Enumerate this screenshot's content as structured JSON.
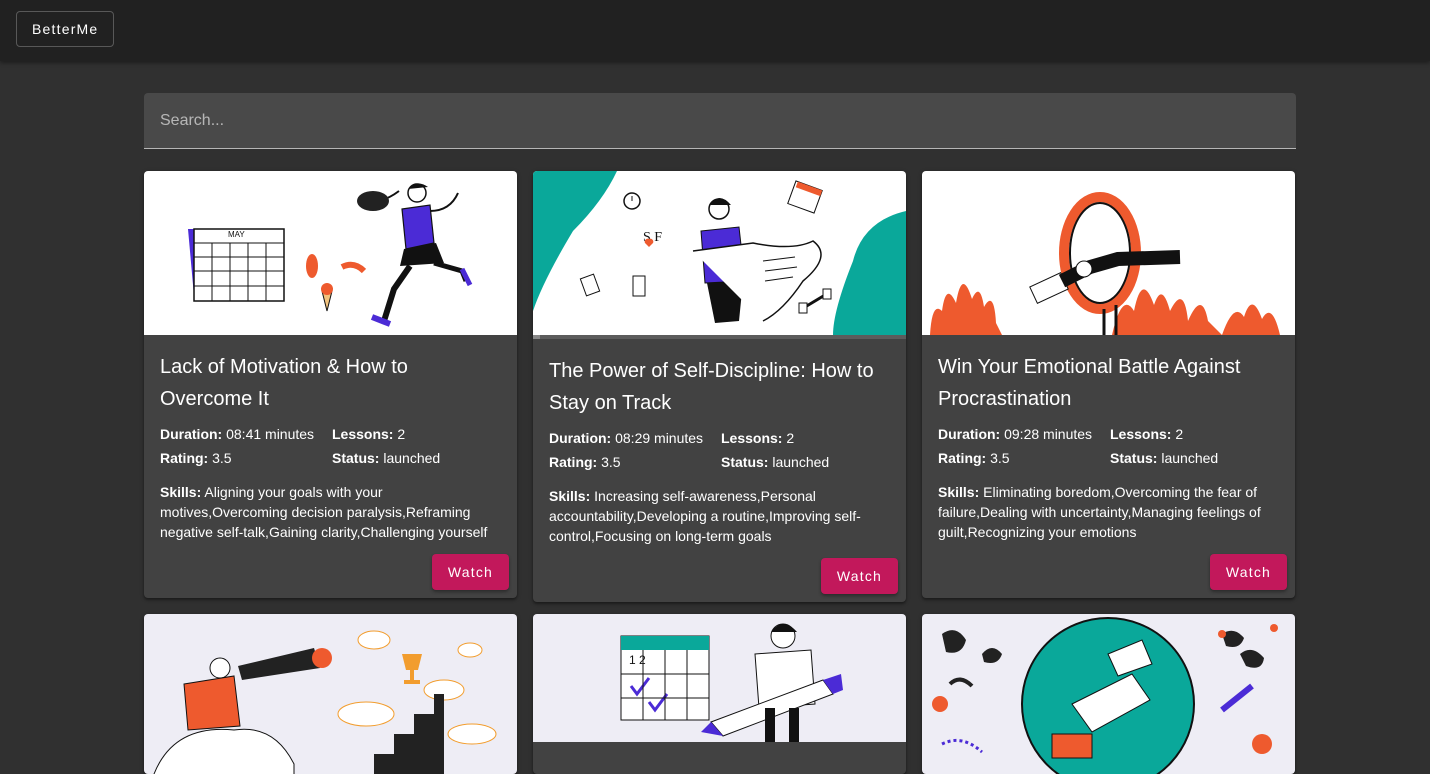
{
  "app": {
    "brand": "BetterMe"
  },
  "search": {
    "placeholder": "Search..."
  },
  "labels": {
    "duration": "Duration:",
    "lessons": "Lessons:",
    "rating": "Rating:",
    "status": "Status:",
    "skills": "Skills:"
  },
  "cards": [
    {
      "title": "Lack of Motivation & How to Overcome It",
      "duration": "08:41 minutes",
      "lessons": "2",
      "rating": "3.5",
      "status": "launched",
      "skills": "Aligning your goals with your motives,Overcoming decision paralysis,Reframing negative self-talk,Gaining clarity,Challenging yourself",
      "action": "Watch",
      "image_icon": "calendar-and-running-woman-illustration"
    },
    {
      "title": "The Power of Self-Discipline: How to Stay on Track",
      "duration": "08:29 minutes",
      "lessons": "2",
      "rating": "3.5",
      "status": "launched",
      "skills": "Increasing self-awareness,Personal accountability,Developing a routine,Improving self-control,Focusing on long-term goals",
      "action": "Watch",
      "image_icon": "woman-with-checklist-illustration",
      "progress": 0.02
    },
    {
      "title": "Win Your Emotional Battle Against Procrastination",
      "duration": "09:28 minutes",
      "lessons": "2",
      "rating": "3.5",
      "status": "launched",
      "skills": "Eliminating boredom,Overcoming the fear of failure,Dealing with uncertainty,Managing feelings of guilt,Recognizing your emotions",
      "action": "Watch",
      "image_icon": "man-jumping-through-fire-ring-illustration"
    },
    {
      "image_icon": "woman-with-telescope-and-trophy-illustration"
    },
    {
      "image_icon": "man-with-pencil-and-calendar-illustration"
    },
    {
      "image_icon": "teal-circle-with-doodles-illustration"
    }
  ],
  "colors": {
    "background": "#303030",
    "appbar": "#212121",
    "card": "#424242",
    "accent": "#c2185b",
    "teal": "#0aa89a",
    "purple": "#4b2bd6",
    "orange": "#ee5a2e"
  }
}
